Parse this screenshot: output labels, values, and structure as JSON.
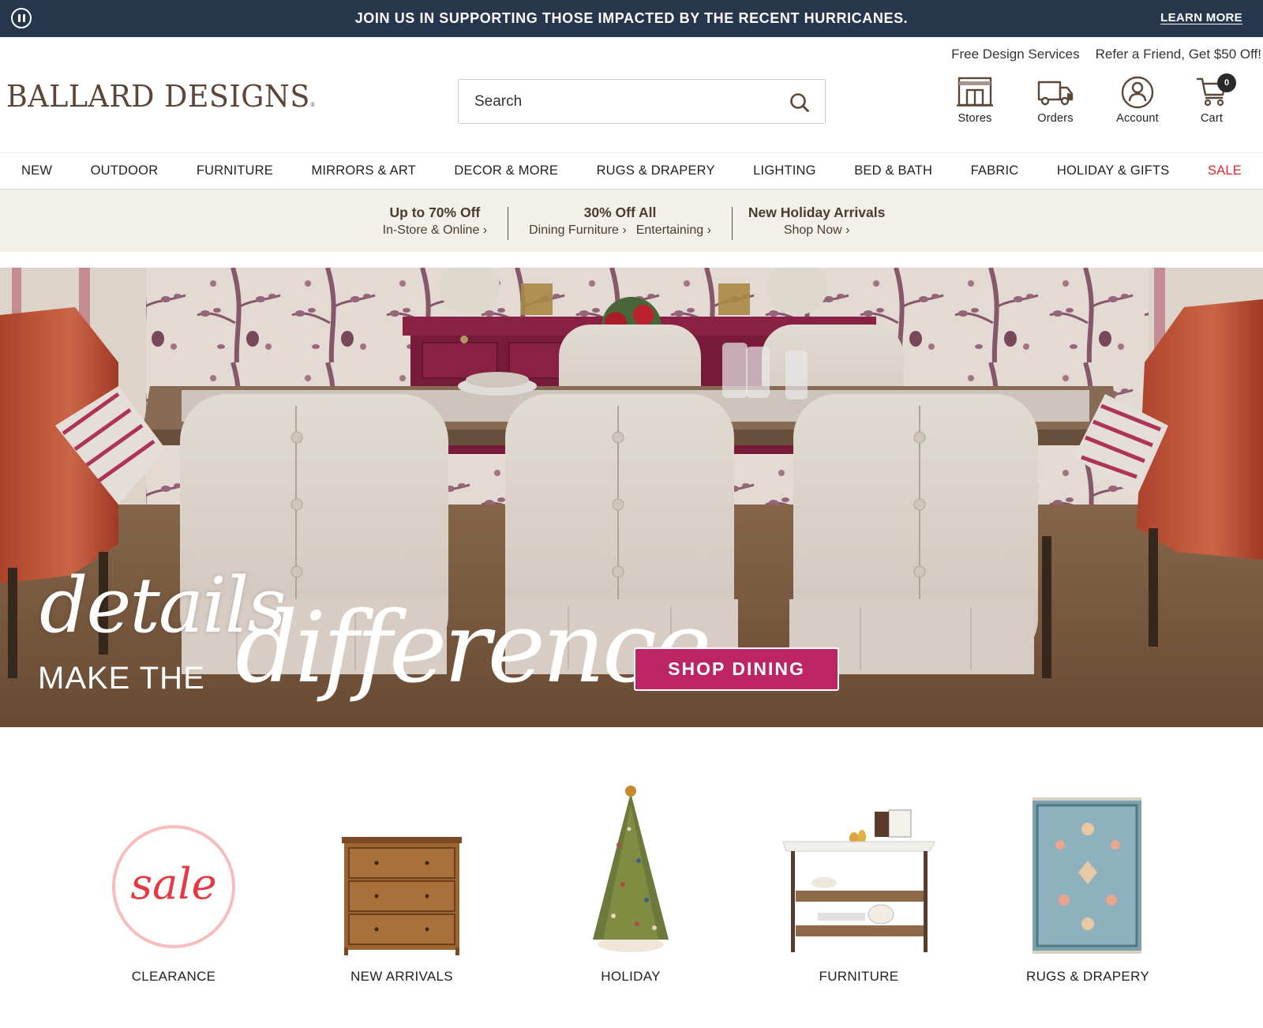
{
  "announcement": {
    "message": "JOIN US IN SUPPORTING THOSE IMPACTED BY THE RECENT HURRICANES.",
    "link": "LEARN MORE",
    "pause_icon": "pause-icon",
    "background": "#25364d"
  },
  "header": {
    "brand": "BALLARD DESIGNS",
    "brand_mark": "®",
    "utility_links": [
      "Free Design Services",
      "Refer a Friend, Get $50 Off!"
    ],
    "search": {
      "placeholder": "Search",
      "value": ""
    },
    "icons": [
      {
        "label": "Stores",
        "icon": "store-icon"
      },
      {
        "label": "Orders",
        "icon": "truck-icon"
      },
      {
        "label": "Account",
        "icon": "account-icon"
      },
      {
        "label": "Cart",
        "icon": "cart-icon",
        "badge": "0"
      }
    ]
  },
  "nav": {
    "items": [
      "NEW",
      "OUTDOOR",
      "FURNITURE",
      "MIRRORS & ART",
      "DECOR & MORE",
      "RUGS & DRAPERY",
      "LIGHTING",
      "BED & BATH",
      "FABRIC",
      "HOLIDAY & GIFTS",
      "SALE"
    ],
    "sale_color": "#e3242b"
  },
  "promos": [
    {
      "title": "Up to 70% Off",
      "links": [
        "In-Store & Online ›"
      ]
    },
    {
      "title": "30% Off All",
      "links": [
        "Dining Furniture ›",
        "Entertaining ›"
      ]
    },
    {
      "title": "New Holiday Arrivals",
      "links": [
        "Shop Now ›"
      ]
    }
  ],
  "hero": {
    "line1": "details",
    "line2": "MAKE THE",
    "line3": "difference",
    "cta": "SHOP DINING",
    "cta_color": "#bc2464"
  },
  "categories": [
    {
      "label": "CLEARANCE",
      "image": "sale-badge",
      "badge_text": "sale"
    },
    {
      "label": "NEW ARRIVALS",
      "image": "wooden-chest"
    },
    {
      "label": "HOLIDAY",
      "image": "christmas-tree"
    },
    {
      "label": "FURNITURE",
      "image": "kitchen-cart"
    },
    {
      "label": "RUGS & DRAPERY",
      "image": "blue-rug"
    }
  ]
}
